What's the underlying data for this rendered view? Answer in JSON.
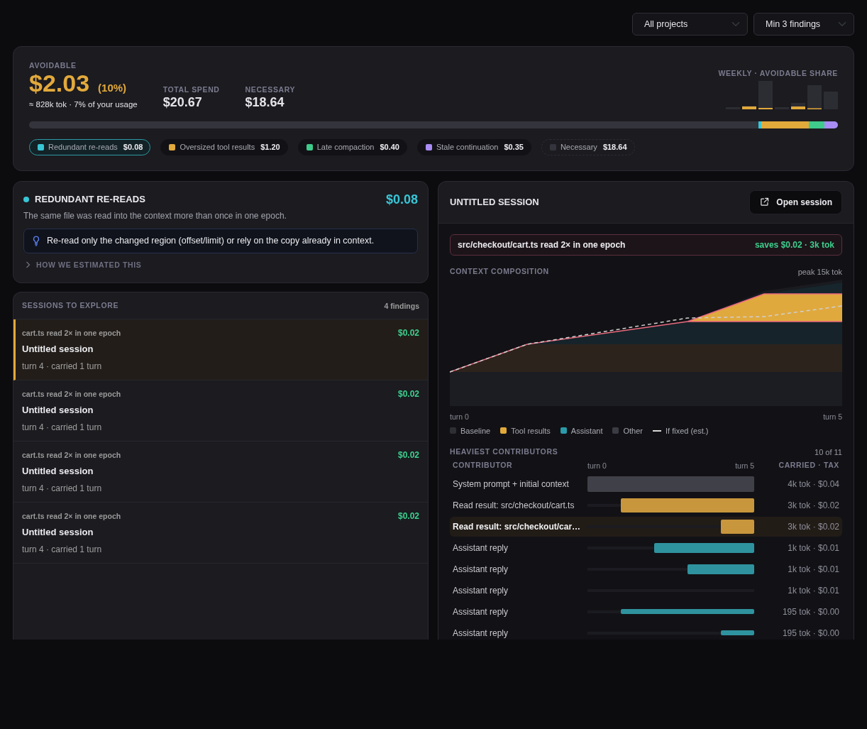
{
  "filters": [
    {
      "value": "All projects"
    },
    {
      "value": "Min 3 findings"
    }
  ],
  "summary": {
    "avoidable": {
      "label": "AVOIDABLE",
      "amount": "$2.03",
      "share": "(10%)",
      "note": "≈ 828k tok · 7% of your usage"
    },
    "stats": [
      {
        "label": "TOTAL SPEND",
        "value": "$20.67"
      },
      {
        "label": "NECESSARY",
        "value": "$18.64"
      }
    ],
    "weekly": {
      "title": "WEEKLY · AVOIDABLE SHARE"
    },
    "categories": [
      {
        "kind": "avoidable",
        "label": "Redundant re-reads",
        "amount": "$0.08",
        "color": "#38c6d6",
        "selected": true
      },
      {
        "kind": "avoidable",
        "label": "Oversized tool results",
        "amount": "$1.20",
        "color": "#e2a93b",
        "selected": false
      },
      {
        "kind": "avoidable",
        "label": "Late compaction",
        "amount": "$0.40",
        "color": "#3ecb8c",
        "selected": false
      },
      {
        "kind": "avoidable",
        "label": "Stale continuation",
        "amount": "$0.35",
        "color": "#a98cf5",
        "selected": false
      },
      {
        "kind": "necessary",
        "label": "Necessary",
        "amount": "$18.64",
        "color": "#34343c",
        "selected": false
      }
    ]
  },
  "finding": {
    "title": "REDUNDANT RE-READS",
    "color": "#38c6d6",
    "amount": "$0.08",
    "description": "The same file was read into the context more than once in one epoch.",
    "tip": "Re-read only the changed region (offset/limit) or rely on the copy already in context.",
    "details": {
      "label": "HOW WE ESTIMATED THIS",
      "expanded": false
    }
  },
  "sessions": {
    "title": "SESSIONS TO EXPLORE",
    "count": "4 findings",
    "items": [
      {
        "finding": "cart.ts read 2× in one epoch",
        "amount": "$0.02",
        "title": "Untitled session",
        "meta": "turn 4 · carried 1 turn",
        "selected": true
      },
      {
        "finding": "cart.ts read 2× in one epoch",
        "amount": "$0.02",
        "title": "Untitled session",
        "meta": "turn 4 · carried 1 turn",
        "selected": false
      },
      {
        "finding": "cart.ts read 2× in one epoch",
        "amount": "$0.02",
        "title": "Untitled session",
        "meta": "turn 4 · carried 1 turn",
        "selected": false
      },
      {
        "finding": "cart.ts read 2× in one epoch",
        "amount": "$0.02",
        "title": "Untitled session",
        "meta": "turn 4 · carried 1 turn",
        "selected": false
      }
    ]
  },
  "session_detail": {
    "title": "UNTITLED SESSION",
    "open_button": "Open session",
    "finding": {
      "text": "src/checkout/cart.ts read 2× in one epoch",
      "savings": "saves $0.02 · 3k tok"
    },
    "composition": {
      "title": "CONTEXT COMPOSITION",
      "peak": "peak 15k tok",
      "x_start": "turn 0",
      "x_end": "turn 5",
      "legend": [
        {
          "kind": "swatch",
          "label": "Baseline",
          "color": "#2e2f35"
        },
        {
          "kind": "swatch",
          "label": "Tool results",
          "color": "#e2a93b"
        },
        {
          "kind": "swatch",
          "label": "Assistant",
          "color": "#2b9ba8"
        },
        {
          "kind": "swatch",
          "label": "Other",
          "color": "#3b3c43"
        },
        {
          "kind": "line",
          "label": "If fixed (est.)",
          "color": "#d8d8d8"
        }
      ]
    },
    "contributors": {
      "title": "HEAVIEST CONTRIBUTORS",
      "count": "10 of 11",
      "columns": {
        "contributor": "CONTRIBUTOR",
        "axis_start": "turn 0",
        "axis_end": "turn 5",
        "carried": "CARRIED · TAX"
      },
      "rows": [
        {
          "label": "System prompt + initial context",
          "kind": "baseline",
          "level": 1,
          "value": "4k tok · $0.04",
          "selected": false
        },
        {
          "label": "Read result: src/checkout/cart.ts",
          "kind": "tool",
          "level": 0.8,
          "value": "3k tok · $0.02",
          "selected": false
        },
        {
          "label": "Read result: src/checkout/car…",
          "kind": "tool",
          "level": 0.2,
          "value": "3k tok · $0.02",
          "selected": true
        },
        {
          "label": "Assistant reply",
          "kind": "reply",
          "level": 0.6,
          "value": "1k tok · $0.01",
          "selected": false
        },
        {
          "label": "Assistant reply",
          "kind": "reply",
          "level": 0.4,
          "value": "1k tok · $0.01",
          "selected": false
        },
        {
          "label": "Assistant reply",
          "kind": "reply",
          "value": "1k tok · $0.01",
          "selected": false
        },
        {
          "label": "Assistant reply",
          "kind": "brief",
          "level": 0.8,
          "value": "195 tok · $0.00",
          "selected": false
        },
        {
          "label": "Assistant reply",
          "kind": "brief",
          "level": 0.2,
          "value": "195 tok · $0.00",
          "selected": false
        }
      ]
    }
  }
}
